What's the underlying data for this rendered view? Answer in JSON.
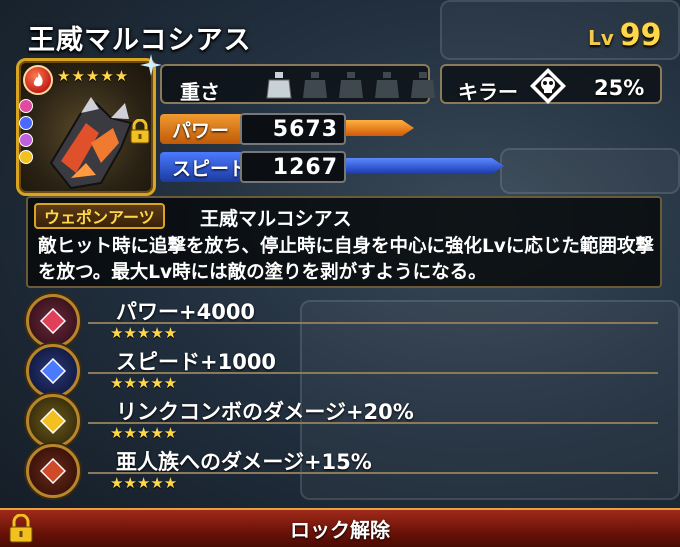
{
  "header": {
    "title": "王威マルコシアス",
    "level_prefix": "Lv",
    "level": "99"
  },
  "portrait": {
    "rarity_stars": "★★★★★",
    "element": "fire",
    "lock_icon": "lock-icon"
  },
  "stats": {
    "weight_label": "重さ",
    "weight_filled": 1,
    "weight_total": 5,
    "killer_label": "キラー",
    "killer_value": "25%",
    "power_label": "パワー",
    "power_value": "5673",
    "speed_label": "スピード",
    "speed_value": "1267"
  },
  "weapon_parts": {
    "tag": "ウェポンアーツ",
    "name": "王威マルコシアス",
    "description": "敵ヒット時に追撃を放ち、停止時に自身を中心に強化Lvに応じた範囲攻撃を放つ。最大Lv時には敵の塗りを剥がすようになる。"
  },
  "abilities": [
    {
      "text": "パワー+4000",
      "stars": "★★★★★",
      "gem_color": "#e0405a"
    },
    {
      "text": "スピード+1000",
      "stars": "★★★★★",
      "gem_color": "#4a7aff"
    },
    {
      "text": "リンクコンボのダメージ+20%",
      "stars": "★★★★★",
      "gem_color": "#f2c020"
    },
    {
      "text": "亜人族へのダメージ+15%",
      "stars": "★★★★★",
      "gem_color": "#d04a2a"
    }
  ],
  "unlock_button": {
    "label": "ロック解除"
  },
  "colors": {
    "gold": "#ffd84a",
    "power_tag": "#e07a10",
    "speed_tag": "#2a5ad0",
    "unlock_red": "#8a1a0a"
  }
}
